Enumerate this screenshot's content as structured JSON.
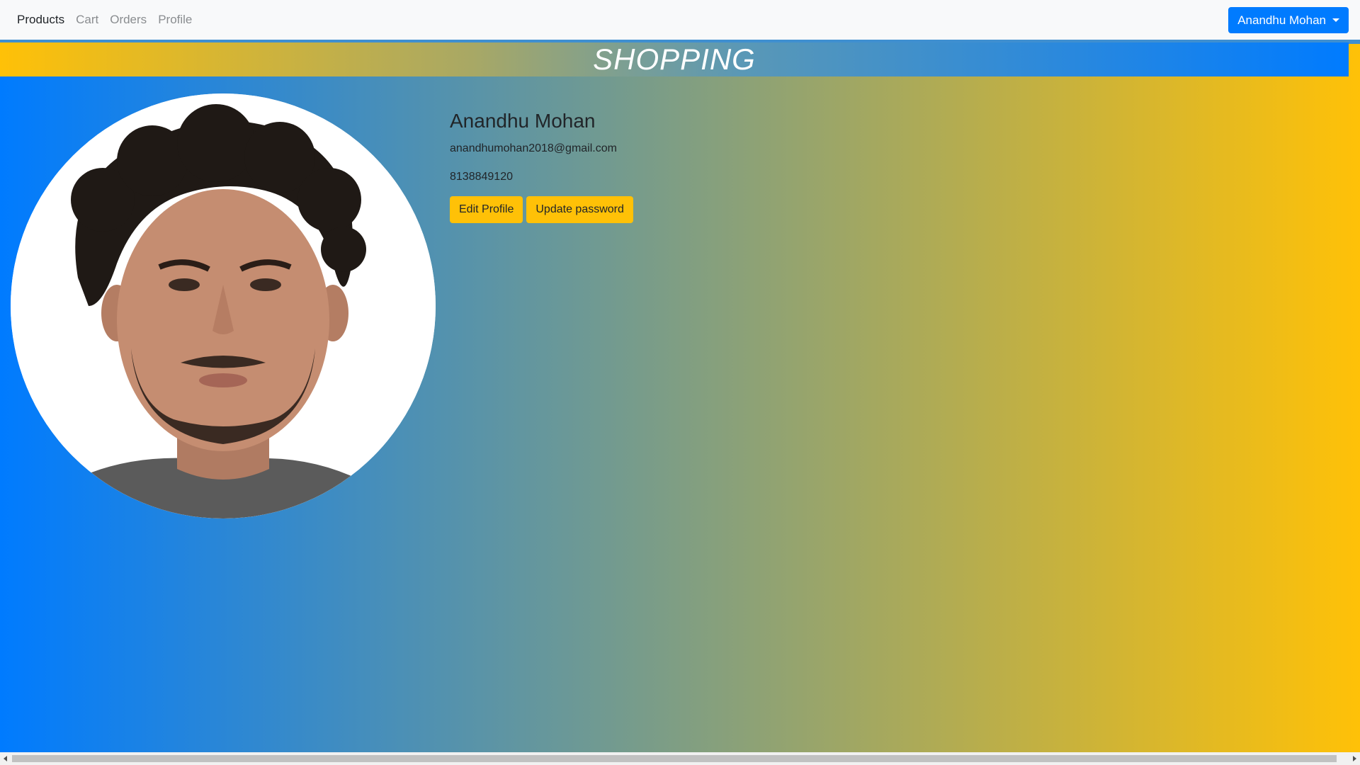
{
  "navbar": {
    "links": [
      "Products",
      "Cart",
      "Orders",
      "Profile"
    ],
    "user_menu_label": "Anandhu Mohan"
  },
  "banner": {
    "title": "SHOPPING"
  },
  "profile": {
    "name": "Anandhu Mohan",
    "email": "anandhumohan2018@gmail.com",
    "phone": "8138849120",
    "edit_button": "Edit Profile",
    "password_button": "Update password"
  },
  "colors": {
    "primary": "#007bff",
    "warning": "#ffc107",
    "navbar_bg": "#f8f9fa"
  },
  "icons": [
    "caret-down-icon",
    "scroll-left-arrow-icon",
    "scroll-right-arrow-icon"
  ]
}
